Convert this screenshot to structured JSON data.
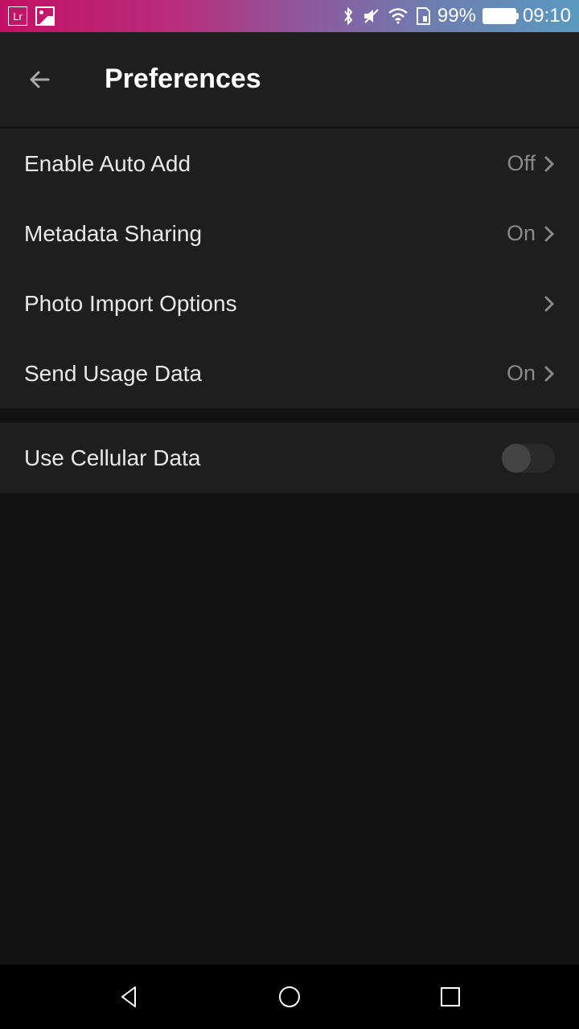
{
  "statusBar": {
    "lrLabel": "Lr",
    "batteryPercent": "99%",
    "time": "09:10"
  },
  "header": {
    "title": "Preferences"
  },
  "settings": {
    "group1": [
      {
        "label": "Enable Auto Add",
        "value": "Off"
      },
      {
        "label": "Metadata Sharing",
        "value": "On"
      },
      {
        "label": "Photo Import Options",
        "value": ""
      },
      {
        "label": "Send Usage Data",
        "value": "On"
      }
    ],
    "group2": [
      {
        "label": "Use Cellular Data",
        "toggle": false
      }
    ]
  }
}
